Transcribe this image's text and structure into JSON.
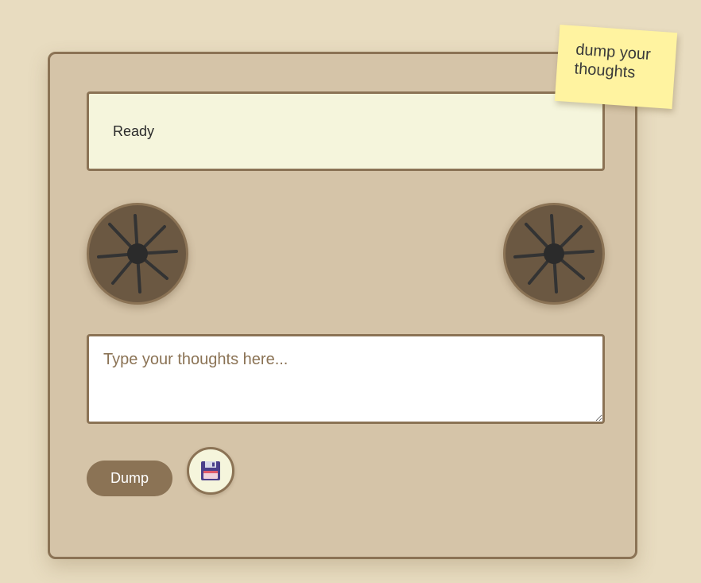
{
  "sticky_note": {
    "text": "dump your thoughts"
  },
  "display": {
    "status": "Ready"
  },
  "reels": {
    "left_icon": "tape-reel-icon",
    "right_icon": "tape-reel-icon"
  },
  "input": {
    "placeholder": "Type your thoughts here...",
    "value": ""
  },
  "controls": {
    "dump_label": "Dump",
    "save_icon": "floppy-disk-icon"
  },
  "colors": {
    "page_background": "#e8dcc0",
    "device_body": "#d5c4a8",
    "border": "#8b7355",
    "display_background": "#f5f5dc",
    "reel": "#6b5842",
    "sticky_note": "#fff3a0"
  }
}
